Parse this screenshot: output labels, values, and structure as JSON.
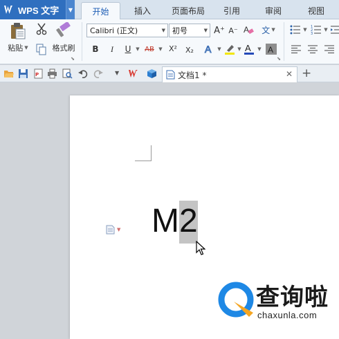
{
  "app": {
    "title": "WPS 文字"
  },
  "tabs": [
    {
      "label": "开始",
      "active": true
    },
    {
      "label": "插入",
      "active": false
    },
    {
      "label": "页面布局",
      "active": false
    },
    {
      "label": "引用",
      "active": false
    },
    {
      "label": "审阅",
      "active": false
    },
    {
      "label": "视图",
      "active": false
    }
  ],
  "ribbon": {
    "paste_label": "粘贴",
    "format_painter_label": "格式刷",
    "font_name": "Calibri (正文)",
    "font_size": "初号",
    "bold": "B",
    "italic": "I",
    "underline": "U",
    "strike": "AB",
    "superscript": "X²",
    "subscript": "X₂",
    "grow_font": "A⁺",
    "shrink_font": "A⁻",
    "phonetic": "文"
  },
  "document": {
    "tab_title": "文档1 *",
    "text_plain": "M",
    "text_selected": "2"
  },
  "watermark": {
    "text": "查询啦",
    "url": "chaxunla.com"
  },
  "colors": {
    "app_blue": "#2f6fbf",
    "active_tab_text": "#1d5db5",
    "selection": "#c4c4c4",
    "workarea": "#d0d4d9",
    "watermark_blue": "#1e88e5",
    "watermark_orange": "#f5a623"
  }
}
